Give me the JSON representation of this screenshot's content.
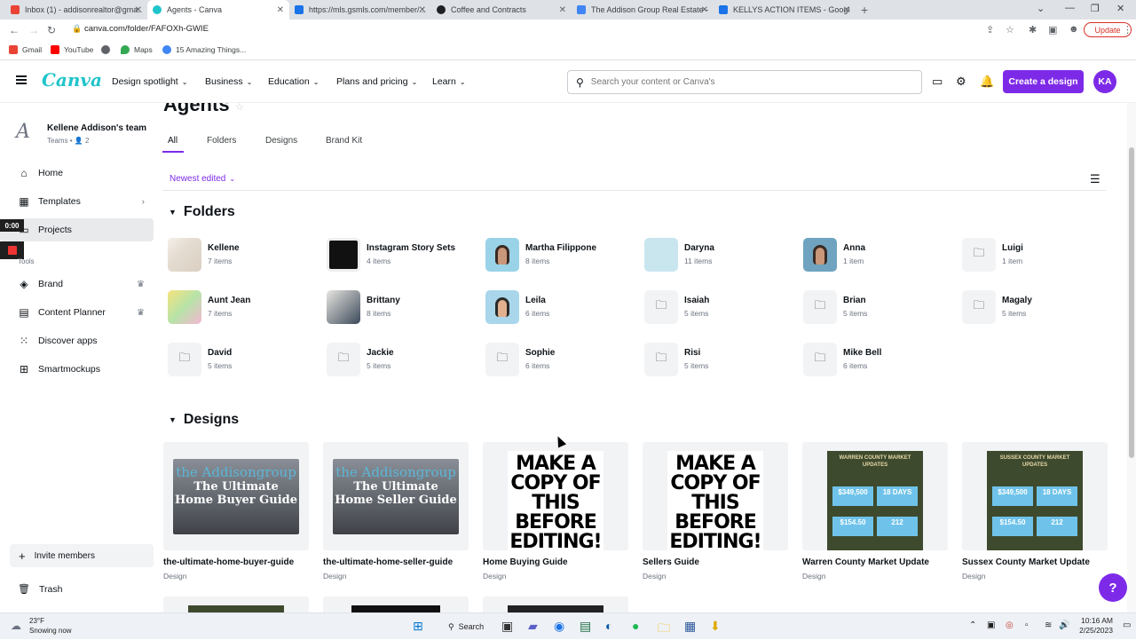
{
  "browser": {
    "tabs": [
      {
        "title": "Inbox (1) - addisonrealtor@gma...",
        "color": "#ea4335",
        "active": false
      },
      {
        "title": "Agents - Canva",
        "color": "#20c4cb",
        "active": true
      },
      {
        "title": "https://mls.gsmls.com/member/...",
        "color": "#1a73e8",
        "active": false
      },
      {
        "title": "Coffee and Contracts",
        "color": "#202124",
        "active": false
      },
      {
        "title": "The Addison Group Real Estate -",
        "color": "#4285f4",
        "active": false
      },
      {
        "title": "KELLYS ACTION ITEMS - Google...",
        "color": "#1a73e8",
        "active": false
      }
    ],
    "url": "canva.com/folder/FAFOXh-GWIE",
    "update_label": "Update",
    "bookmarks": [
      {
        "label": "Gmail",
        "color": "#ea4335"
      },
      {
        "label": "YouTube",
        "color": "#ff0000"
      },
      {
        "label": "",
        "color": "#5f6368"
      },
      {
        "label": "Maps",
        "color": "#34a853"
      },
      {
        "label": "15 Amazing Things...",
        "color": "#4285f4"
      }
    ]
  },
  "header": {
    "logo": "Canva",
    "nav": [
      "Design spotlight",
      "Business",
      "Education",
      "Plans and pricing",
      "Learn"
    ],
    "search_placeholder": "Search your content or Canva's",
    "create_label": "Create a design",
    "avatar_initials": "KA",
    "accent": "#7d2ae8"
  },
  "sidebar": {
    "team_name": "Kellene Addison's team",
    "team_sub": "Teams • 👤 2",
    "items": [
      {
        "label": "Home"
      },
      {
        "label": "Templates"
      },
      {
        "label": "Projects"
      }
    ],
    "tools_label": "Tools",
    "tools": [
      {
        "label": "Brand"
      },
      {
        "label": "Content Planner"
      },
      {
        "label": "Discover apps"
      },
      {
        "label": "Smartmockups"
      }
    ],
    "invite_label": "Invite members",
    "trash_label": "Trash",
    "timer": "0:00"
  },
  "main": {
    "title": "Agents",
    "tabs": [
      "All",
      "Folders",
      "Designs",
      "Brand Kit"
    ],
    "sort_label": "Newest edited",
    "folders_heading": "Folders",
    "designs_heading": "Designs",
    "folders": [
      {
        "name": "Kellene",
        "count": "7 items"
      },
      {
        "name": "Instagram Story Sets",
        "count": "4 items"
      },
      {
        "name": "Martha Filippone",
        "count": "8 items"
      },
      {
        "name": "Daryna",
        "count": "11 items"
      },
      {
        "name": "Anna",
        "count": "1 item"
      },
      {
        "name": "Luigi",
        "count": "1 item"
      },
      {
        "name": "Aunt Jean",
        "count": "7 items"
      },
      {
        "name": "Brittany",
        "count": "8 items"
      },
      {
        "name": "Leila",
        "count": "6 items"
      },
      {
        "name": "Isaiah",
        "count": "5 items"
      },
      {
        "name": "Brian",
        "count": "5 items"
      },
      {
        "name": "Magaly",
        "count": "5 items"
      },
      {
        "name": "David",
        "count": "5 items"
      },
      {
        "name": "Jackie",
        "count": "5 items"
      },
      {
        "name": "Sophie",
        "count": "6 items"
      },
      {
        "name": "Risi",
        "count": "5 items"
      },
      {
        "name": "Mike Bell",
        "count": "6 items"
      }
    ],
    "designs": [
      {
        "title": "the-ultimate-home-buyer-guide",
        "type": "Design",
        "thumb_top": "the Addisongroup",
        "thumb_main": "The Ultimate Home Buyer Guide"
      },
      {
        "title": "the-ultimate-home-seller-guide",
        "type": "Design",
        "thumb_top": "the Addisongroup",
        "thumb_main": "The Ultimate Home Seller Guide"
      },
      {
        "title": "Home Buying Guide",
        "type": "Design",
        "thumb_main": "MAKE A COPY OF THIS BEFORE EDITING!"
      },
      {
        "title": "Sellers Guide",
        "type": "Design",
        "thumb_main": "MAKE A COPY OF THIS BEFORE EDITING!"
      },
      {
        "title": "Warren County Market Update",
        "type": "Design",
        "thumb_head": "WARREN COUNTY MARKET UPDATES",
        "stats": [
          [
            "$349,500",
            "18 DAYS"
          ],
          [
            "$154.50",
            "212"
          ]
        ]
      },
      {
        "title": "Sussex County Market Update",
        "type": "Design",
        "thumb_head": "SUSSEX COUNTY MARKET UPDATES",
        "stats": [
          [
            "$349,500",
            "18 DAYS"
          ],
          [
            "$154.50",
            "212"
          ]
        ]
      }
    ]
  },
  "taskbar": {
    "weather_temp": "23°F",
    "weather_desc": "Snowing now",
    "search_label": "Search",
    "time": "10:16 AM",
    "date": "2/25/2023"
  }
}
